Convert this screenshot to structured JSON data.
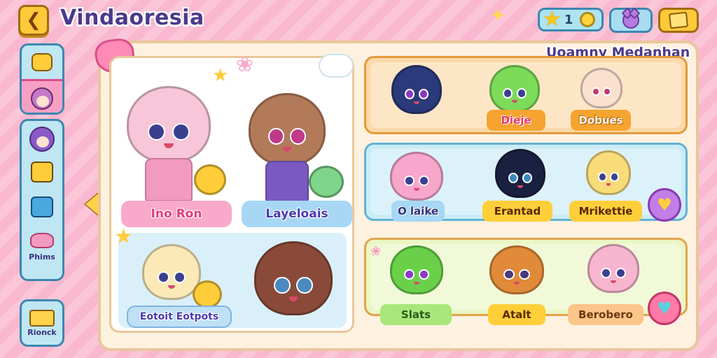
{
  "header": {
    "title": "Vindaoresia",
    "back_icon": "chevron-left-icon",
    "currency_value": "1",
    "currency_icon": "star-icon"
  },
  "sidebar": {
    "items": [
      {
        "icon": "cat-face-icon"
      },
      {
        "icon": "girl-avatar-icon",
        "active": true
      },
      {
        "icon": "purple-hair-avatar-icon"
      },
      {
        "icon": "yellow-box-icon"
      },
      {
        "icon": "blue-box-icon"
      },
      {
        "icon": "pink-creature-icon",
        "label": "Phims"
      }
    ],
    "bottom": {
      "icon": "cheese-icon",
      "label": "Rionck"
    }
  },
  "featured": {
    "labels": [
      "Ino Ron",
      "Layeloais",
      "Eotoit Eotpots"
    ]
  },
  "section": {
    "title": "Uoamny Medanhan"
  },
  "rows": [
    {
      "tags": [
        "Dieje",
        "Dobues"
      ]
    },
    {
      "tags": [
        "O laike",
        "Erantad",
        "Mrikettie"
      ]
    },
    {
      "tags": [
        "Slats",
        "Atalt",
        "Berobero"
      ]
    }
  ],
  "colors": {
    "accent": "#4a3a8a",
    "pink": "#f9a9c9",
    "orange": "#f5a430",
    "blue": "#a7d7f5"
  }
}
